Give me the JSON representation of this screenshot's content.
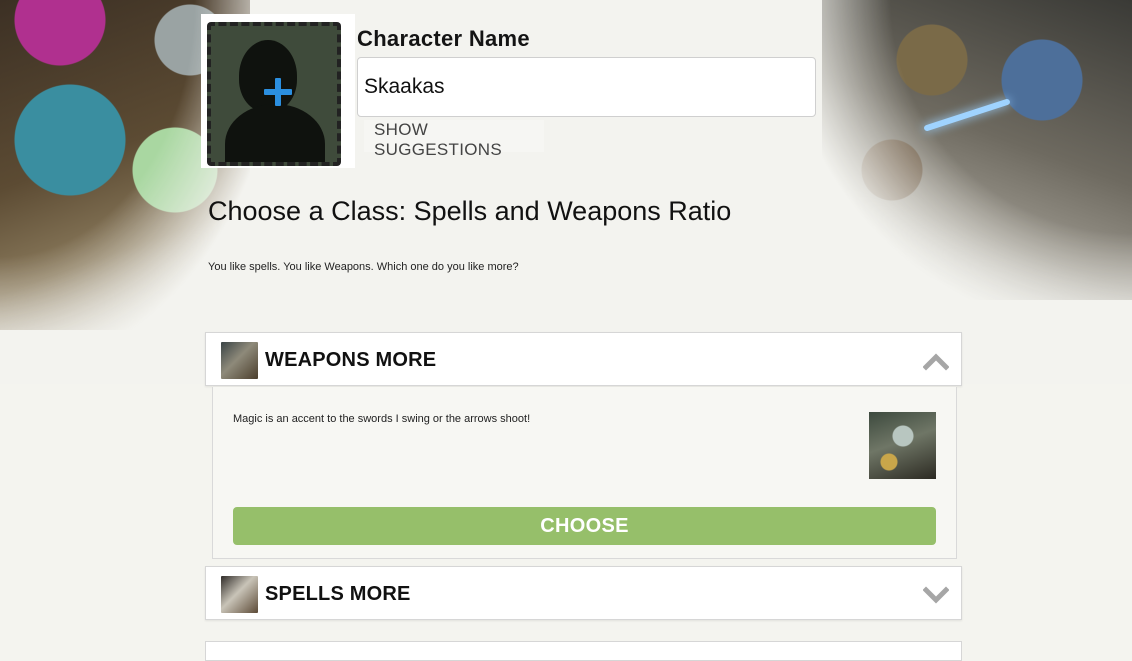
{
  "character": {
    "name_label": "Character Name",
    "name_value": "Skaakas",
    "suggestions_label": "SHOW SUGGESTIONS"
  },
  "section": {
    "title": "Choose a Class: Spells and Weapons Ratio",
    "description": "You like spells. You like Weapons. Which one do you like more?"
  },
  "options": [
    {
      "title": "WEAPONS MORE",
      "expanded": true,
      "description": "Magic is an accent to the swords I swing or the arrows  shoot!",
      "choose_label": "CHOOSE",
      "toggle_icon": "chevron-up-icon"
    },
    {
      "title": "SPELLS MORE",
      "expanded": false,
      "toggle_icon": "chevron-down-icon"
    }
  ],
  "colors": {
    "choose_button": "#96bf6a",
    "add_portrait_plus": "#2b8fe0",
    "chevron": "#a6a6a6"
  },
  "icons": {
    "portrait_add": "plus-icon",
    "portrait_placeholder": "silhouette-icon"
  }
}
